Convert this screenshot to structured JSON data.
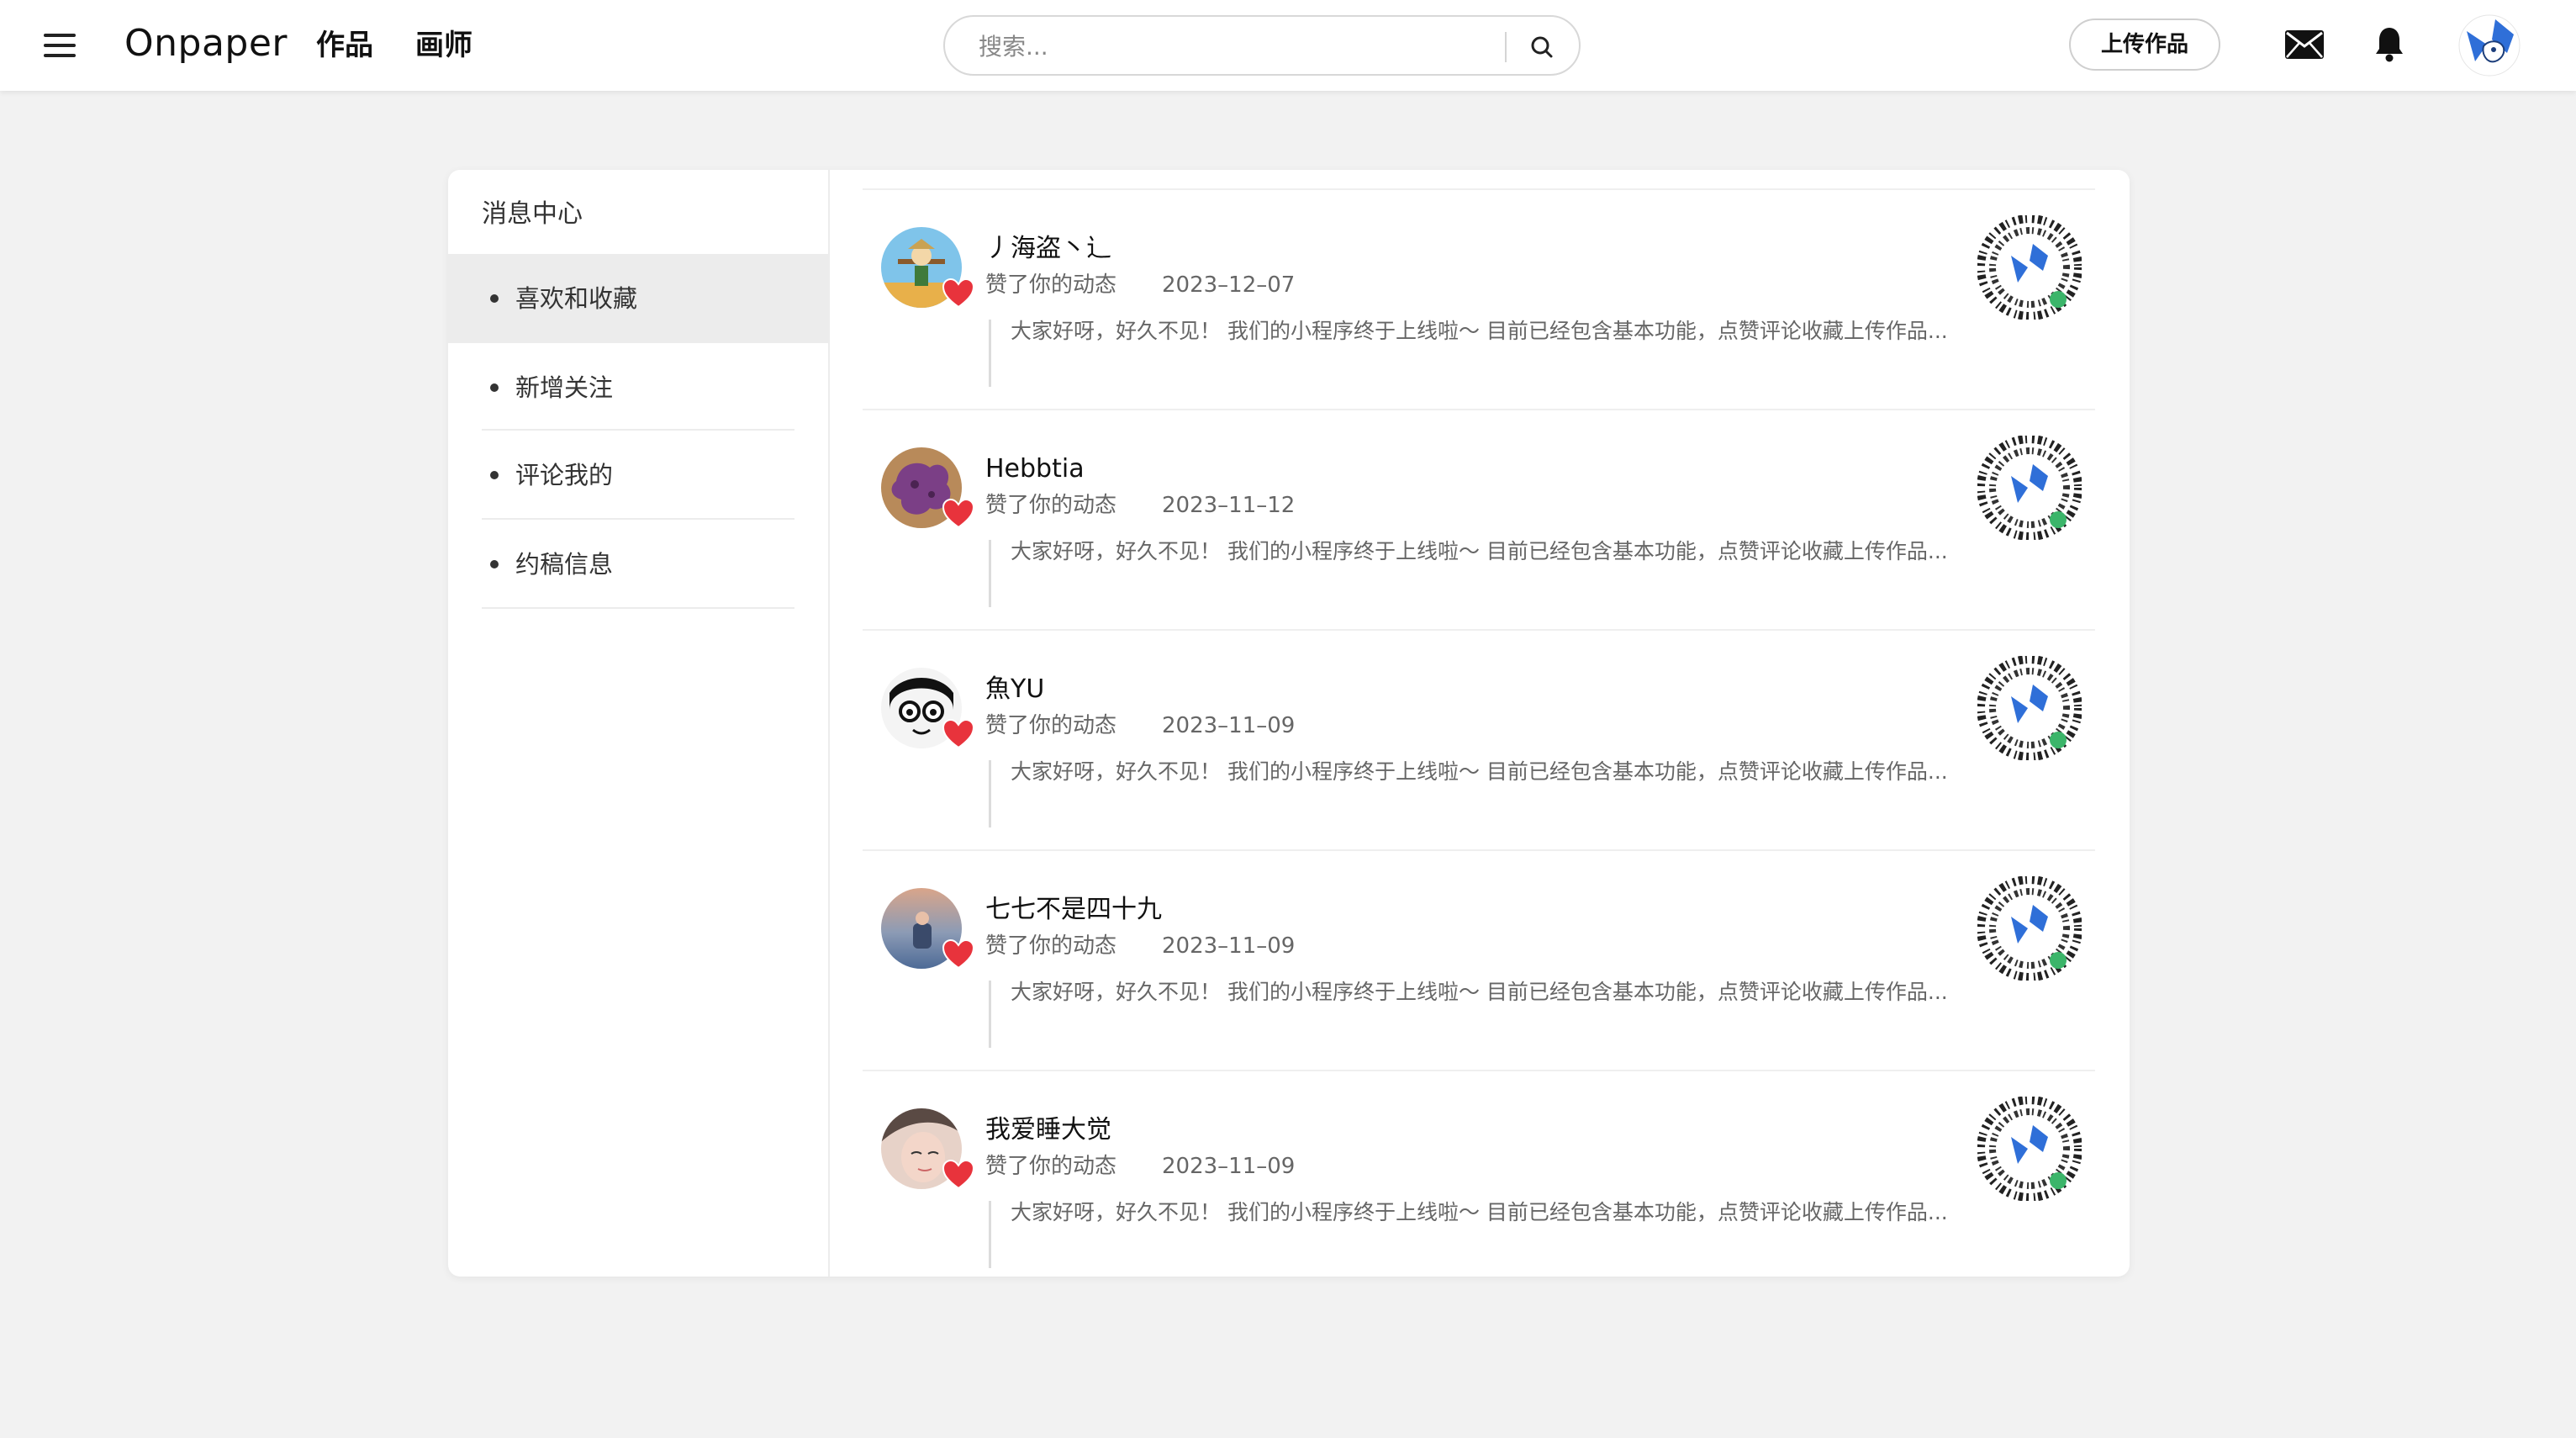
{
  "header": {
    "logo": "Onpaper",
    "nav": [
      "作品",
      "画师"
    ],
    "search_placeholder": "搜索...",
    "upload_label": "上传作品",
    "icons": [
      "menu-icon",
      "search-icon",
      "mail-icon",
      "bell-icon"
    ]
  },
  "sidebar": {
    "title": "消息中心",
    "items": [
      {
        "label": "喜欢和收藏",
        "active": true
      },
      {
        "label": "新增关注",
        "active": false
      },
      {
        "label": "评论我的",
        "active": false
      },
      {
        "label": "约稿信息",
        "active": false
      }
    ]
  },
  "messages": [
    {
      "user": "丿海盗丶辶",
      "action": "赞了你的动态",
      "date": "2023–12–07",
      "content": "大家好呀，好久不见！ 我们的小程序终于上线啦～ 目前已经包含基本功能，点赞评论收藏上传作品..."
    },
    {
      "user": "Hebbtia",
      "action": "赞了你的动态",
      "date": "2023–11–12",
      "content": "大家好呀，好久不见！ 我们的小程序终于上线啦～ 目前已经包含基本功能，点赞评论收藏上传作品..."
    },
    {
      "user": "魚YU",
      "action": "赞了你的动态",
      "date": "2023–11–09",
      "content": "大家好呀，好久不见！ 我们的小程序终于上线啦～ 目前已经包含基本功能，点赞评论收藏上传作品..."
    },
    {
      "user": "七七不是四十九",
      "action": "赞了你的动态",
      "date": "2023–11–09",
      "content": "大家好呀，好久不见！ 我们的小程序终于上线啦～ 目前已经包含基本功能，点赞评论收藏上传作品..."
    },
    {
      "user": "我爱睡大觉",
      "action": "赞了你的动态",
      "date": "2023–11–09",
      "content": "大家好呀，好久不见！ 我们的小程序终于上线啦～ 目前已经包含基本功能，点赞评论收藏上传作品..."
    }
  ],
  "colors": {
    "background": "#f2f2f2",
    "card": "#ffffff",
    "active_item": "#ececec",
    "heart": "#e8333c",
    "brand_blue": "#2f6fd8"
  }
}
